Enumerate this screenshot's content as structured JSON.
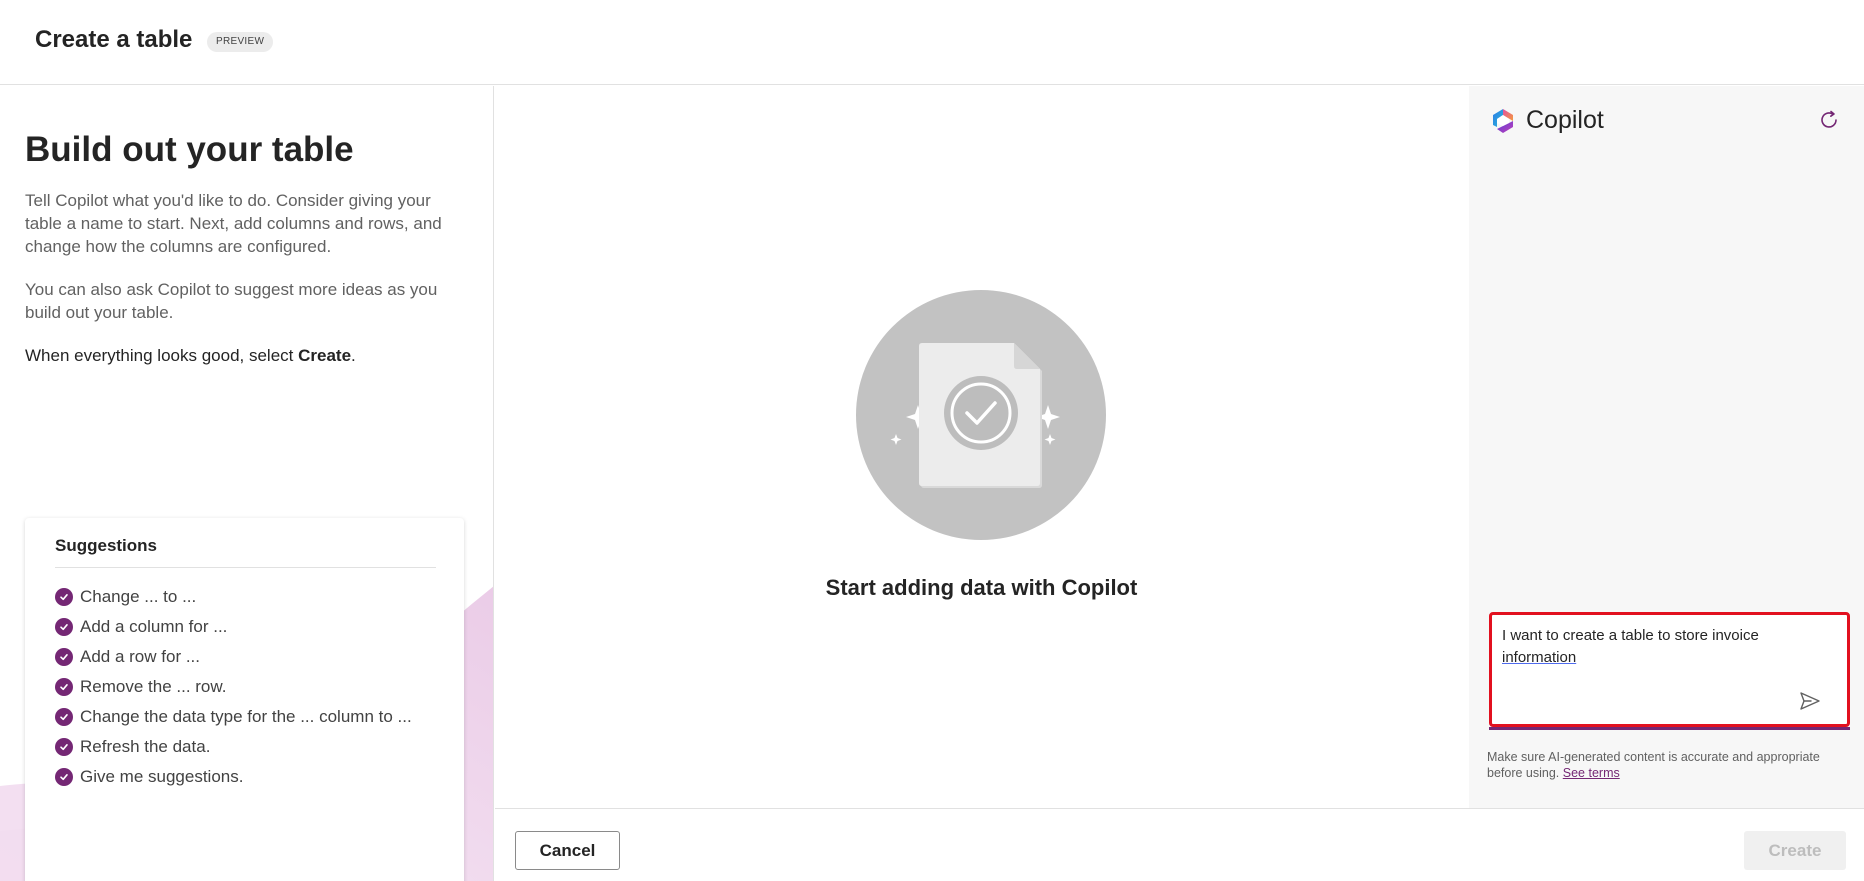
{
  "header": {
    "title": "Create a table",
    "badge": "PREVIEW"
  },
  "left": {
    "heading": "Build out your table",
    "para1": "Tell Copilot what you'd like to do. Consider giving your table a name to start. Next, add columns and rows, and change how the columns are configured.",
    "para2": "You can also ask Copilot to suggest more ideas as you build out your table.",
    "para3_prefix": "When everything looks good, select ",
    "para3_bold": "Create",
    "para3_suffix": ".",
    "suggestions": {
      "title": "Suggestions",
      "items": [
        "Change ... to ...",
        "Add a column for ...",
        "Add a row for ...",
        "Remove the ... row.",
        "Change the data type for the ... column to ...",
        "Refresh the data.",
        "Give me suggestions."
      ]
    }
  },
  "center": {
    "caption": "Start adding data with Copilot",
    "illustration_icon": "document-check-icon"
  },
  "copilot": {
    "title": "Copilot",
    "input_text_main": "I want to create a table to store invoice ",
    "input_text_underlined": "information",
    "disclaimer": "Make sure AI-generated content is accurate and appropriate before using.",
    "terms_link": "See terms"
  },
  "footer": {
    "cancel_label": "Cancel",
    "create_label": "Create"
  },
  "colors": {
    "accent": "#742774",
    "highlight_border": "#e2101f"
  }
}
